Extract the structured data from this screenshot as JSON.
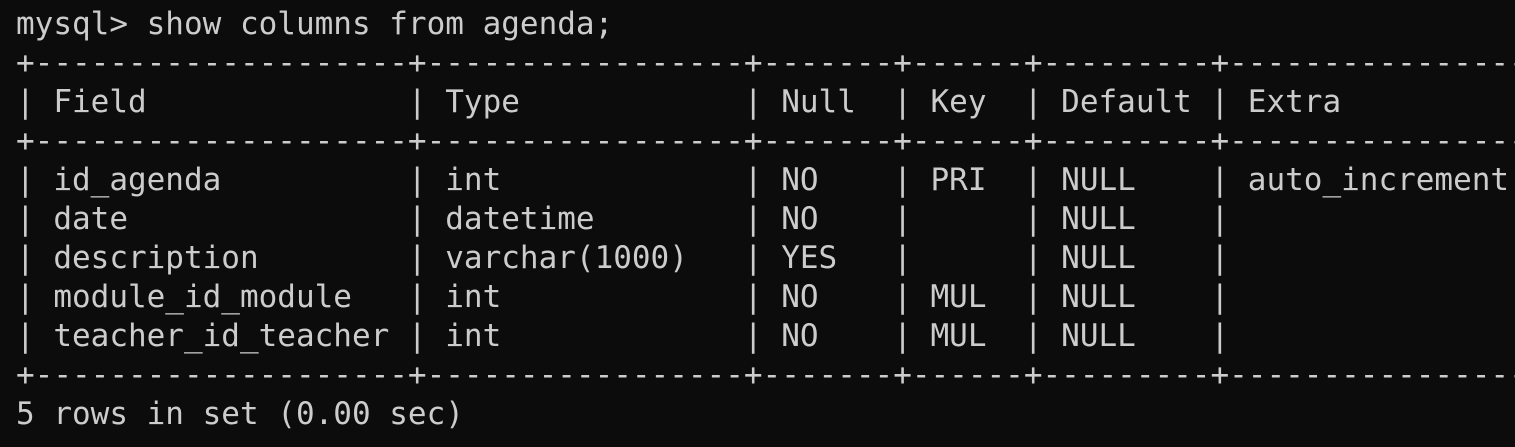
{
  "terminal": {
    "prompt": "mysql> show columns from agenda;",
    "separator": "+--------------------+-----------------+-------+------+---------+----------------+",
    "header": "| Field              | Type            | Null  | Key  | Default | Extra          |",
    "columns": [
      "Field",
      "Type",
      "Null",
      "Key",
      "Default",
      "Extra"
    ],
    "rows": [
      {
        "field": "id_agenda",
        "type": "int",
        "null": "NO",
        "key": "PRI",
        "default": "NULL",
        "extra": "auto_increment",
        "text": "| id_agenda          | int             | NO    | PRI  | NULL    | auto_increment |"
      },
      {
        "field": "date",
        "type": "datetime",
        "null": "NO",
        "key": "",
        "default": "NULL",
        "extra": "",
        "text": "| date               | datetime        | NO    |      | NULL    |                |"
      },
      {
        "field": "description",
        "type": "varchar(1000)",
        "null": "YES",
        "key": "",
        "default": "NULL",
        "extra": "",
        "text": "| description        | varchar(1000)   | YES   |      | NULL    |                |"
      },
      {
        "field": "module_id_module",
        "type": "int",
        "null": "NO",
        "key": "MUL",
        "default": "NULL",
        "extra": "",
        "text": "| module_id_module   | int             | NO    | MUL  | NULL    |                |"
      },
      {
        "field": "teacher_id_teacher",
        "type": "int",
        "null": "NO",
        "key": "MUL",
        "default": "NULL",
        "extra": "",
        "text": "| teacher_id_teacher | int             | NO    | MUL  | NULL    |                |"
      }
    ],
    "footer": "5 rows in set (0.00 sec)"
  },
  "colors": {
    "background": "#0c0c0c",
    "text": "#cccccc"
  }
}
